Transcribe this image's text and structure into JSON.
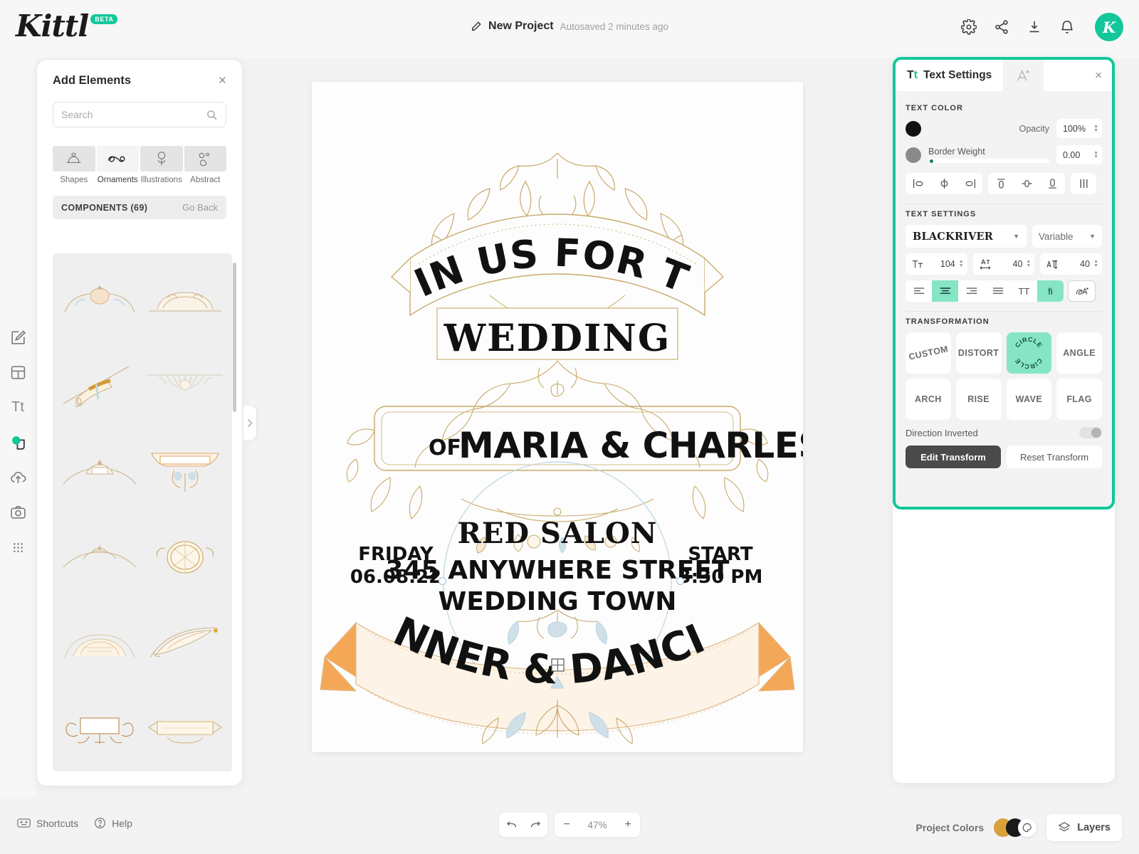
{
  "app": {
    "logo": "Kittl",
    "logo_badge": "BETA",
    "accent_color": "#12c79a",
    "highlight_color": "#86e6c4"
  },
  "header": {
    "project_title": "New Project",
    "autosave_status": "Autosaved 2 minutes ago",
    "pencil_icon": "pencil-icon",
    "icons": [
      {
        "name": "settings-gear-icon"
      },
      {
        "name": "share-icon"
      },
      {
        "name": "download-icon"
      },
      {
        "name": "notifications-bell-icon"
      }
    ],
    "avatar_letter": "K"
  },
  "rail": {
    "items": [
      {
        "name": "edit-design-tool",
        "icon": "pencil-square-icon"
      },
      {
        "name": "templates-tool",
        "icon": "layout-grid-icon"
      },
      {
        "name": "text-tool",
        "icon": "text-tt-icon",
        "label": "Tt"
      },
      {
        "name": "elements-tool",
        "icon": "shapes-circle-icon",
        "active": true
      },
      {
        "name": "uploads-tool",
        "icon": "upload-cloud-icon"
      },
      {
        "name": "photos-tool",
        "icon": "camera-icon"
      },
      {
        "name": "more-tool",
        "icon": "dots-grid-icon"
      }
    ]
  },
  "elements_panel": {
    "title": "Add Elements",
    "close_label": "×",
    "search": {
      "value": "",
      "placeholder": "Search",
      "icon": "search-icon"
    },
    "categories": [
      {
        "label": "Shapes",
        "icon": "shapes-icon",
        "active": false
      },
      {
        "label": "Ornaments",
        "icon": "ornament-swirl-icon",
        "active": true
      },
      {
        "label": "Illustrations",
        "icon": "flower-illustration-icon",
        "active": false
      },
      {
        "label": "Abstract",
        "icon": "abstract-blobs-icon",
        "active": false
      }
    ],
    "components_header": "COMPONENTS (69)",
    "go_back": "Go Back",
    "thumbnails": [
      {
        "name": "ornament-crown-cameo"
      },
      {
        "name": "ornament-arched-banner"
      },
      {
        "name": "ornament-diagonal-ribbon"
      },
      {
        "name": "ornament-fan-divider"
      },
      {
        "name": "ornament-tiara-crest"
      },
      {
        "name": "ornament-scroll-bracket"
      },
      {
        "name": "ornament-crown-flourish"
      },
      {
        "name": "ornament-oval-badge"
      },
      {
        "name": "ornament-lace-arch"
      },
      {
        "name": "ornament-feather-sweep"
      },
      {
        "name": "ornament-frame-plaque"
      },
      {
        "name": "ornament-ribbon-bar"
      }
    ],
    "collapse_icon": "chevron-right-icon"
  },
  "canvas": {
    "design": {
      "line_join": "JOIN US FOR THE",
      "line_wedding": "WEDDING",
      "line_of": "OF",
      "line_names": "MARIA & CHARLES",
      "venue": "RED SALON",
      "address": "345 ANYWHERE STREET",
      "city": "WEDDING TOWN",
      "left_label": "FRIDAY",
      "left_value": "06.08.22",
      "right_label": "START",
      "right_value": "3:30 PM",
      "banner": "DINNER & DANCING"
    },
    "colors": {
      "gold": "#c9a96a",
      "orange": "#f4a857",
      "cream": "#fbf2e6",
      "blue": "#cfe0e8",
      "ink": "#111111"
    }
  },
  "text_settings": {
    "tab_label": "Text Settings",
    "tab_icon": "text-tt-icon",
    "ai_tab_icon": "magic-text-icon",
    "close_label": "×",
    "text_color": {
      "section_label": "TEXT COLOR",
      "fill_swatch": "#111111",
      "opacity_label": "Opacity",
      "opacity_value": "100%",
      "border_swatch": "#8a8a8a",
      "border_weight_label": "Border Weight",
      "border_weight_value": "0.00"
    },
    "align_buttons": [
      {
        "name": "align-left-icon"
      },
      {
        "name": "align-center-horizontal-icon"
      },
      {
        "name": "align-right-icon"
      },
      {
        "name": "align-top-icon"
      },
      {
        "name": "align-middle-vertical-icon"
      },
      {
        "name": "align-bottom-icon"
      },
      {
        "name": "distribute-icon"
      }
    ],
    "settings": {
      "section_label": "TEXT SETTINGS",
      "font_family": "BLACKRIVER",
      "font_variant": "Variable",
      "font_size_icon": "font-size-icon",
      "font_size": "104",
      "letter_spacing_icon": "letter-spacing-icon",
      "letter_spacing": "40",
      "line_height_icon": "line-height-icon",
      "line_height": "40",
      "paragraph_buttons": [
        {
          "name": "text-align-left-icon",
          "active": false
        },
        {
          "name": "text-align-center-icon",
          "active": true
        },
        {
          "name": "text-align-right-icon",
          "active": false
        },
        {
          "name": "text-align-justify-icon",
          "active": false
        }
      ],
      "uppercase_label": "TT",
      "ligature_label": "fi",
      "ligature_active": true,
      "more_type_icon": "advanced-type-icon"
    },
    "transformation": {
      "section_label": "TRANSFORMATION",
      "options": [
        {
          "label": "CUSTOM",
          "active": false
        },
        {
          "label": "DISTORT",
          "active": false
        },
        {
          "label": "CIRCLE",
          "active": true
        },
        {
          "label": "ANGLE",
          "active": false
        },
        {
          "label": "ARCH",
          "active": false
        },
        {
          "label": "RISE",
          "active": false
        },
        {
          "label": "WAVE",
          "active": false
        },
        {
          "label": "FLAG",
          "active": false
        }
      ],
      "direction_inverted_label": "Direction Inverted",
      "direction_inverted_on": false,
      "edit_transform": "Edit Transform",
      "reset_transform": "Reset Transform"
    }
  },
  "bottom_bar": {
    "shortcuts_label": "Shortcuts",
    "shortcuts_icon": "keyboard-icon",
    "help_label": "Help",
    "help_icon": "question-circle-icon",
    "undo_icon": "undo-arrow-icon",
    "redo_icon": "redo-arrow-icon",
    "zoom_out": "−",
    "zoom_value": "47%",
    "zoom_in": "+",
    "project_colors_label": "Project Colors",
    "project_color_swatches": [
      "#d8a13c",
      "#1a1a1a"
    ],
    "palette_icon": "palette-icon",
    "layers_label": "Layers",
    "layers_icon": "layers-stack-icon"
  }
}
